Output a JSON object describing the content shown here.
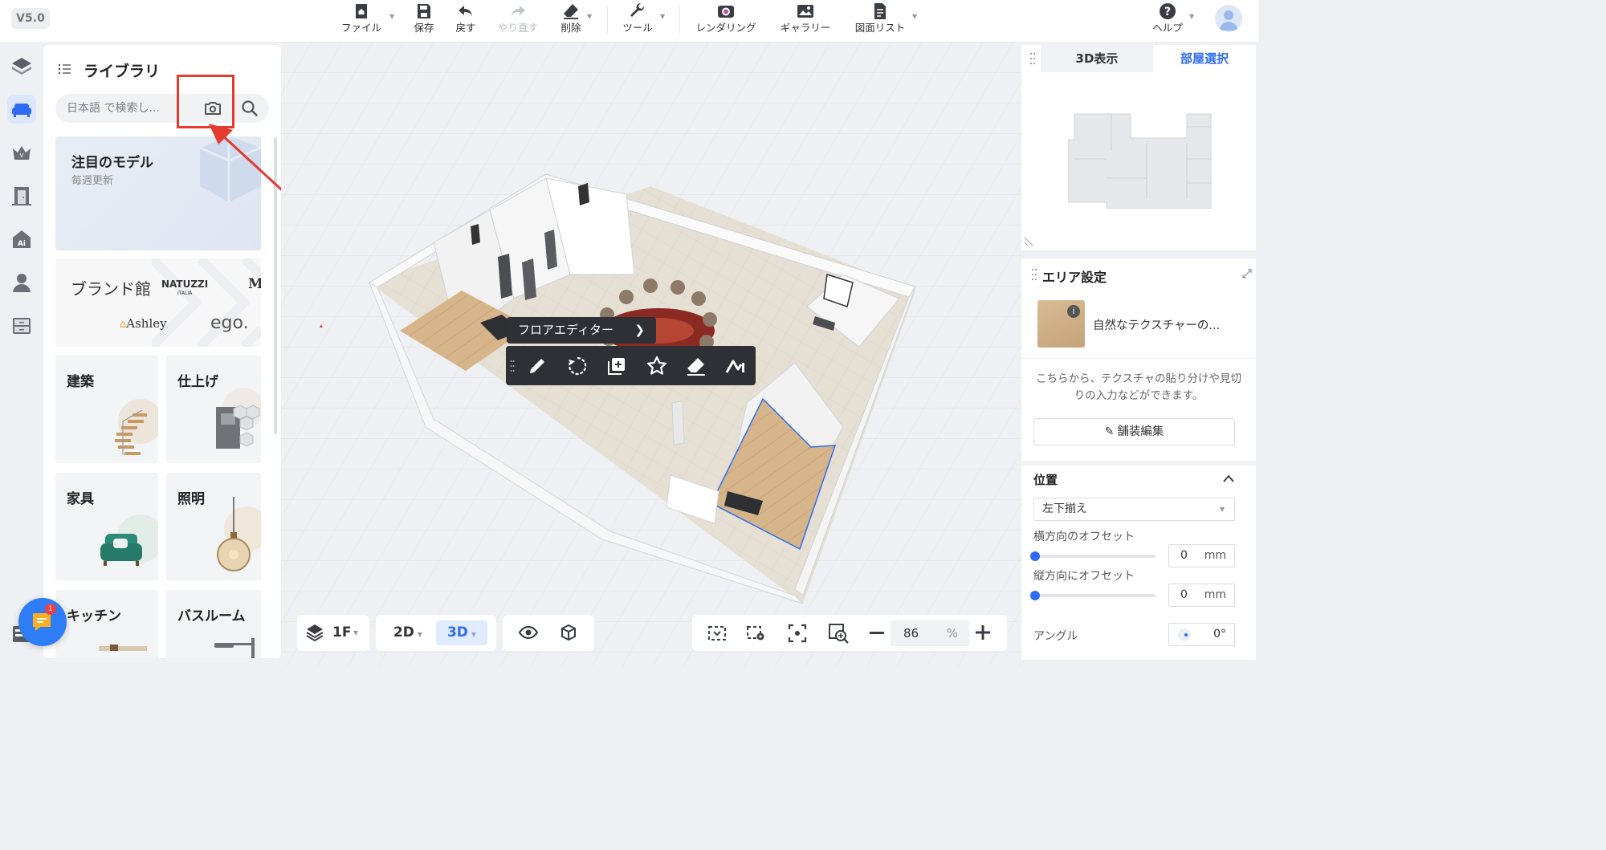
{
  "app": {
    "version": "V5.0"
  },
  "toolbar": {
    "file": "ファイル",
    "save": "保存",
    "undo": "戻す",
    "redo": "やり直す",
    "delete": "削除",
    "tools": "ツール",
    "rendering": "レンダリング",
    "gallery": "ギャラリー",
    "drawing_list": "図面リスト",
    "help": "ヘルプ"
  },
  "library": {
    "title": "ライブラリ",
    "search_placeholder": "日本語 で検索し...",
    "featured": {
      "title": "注目のモデル",
      "subtitle": "毎週更新"
    },
    "brand": {
      "title": "ブランド館",
      "logos": [
        "NATUZZI",
        "ITALIA",
        "M",
        "Ashley",
        "ego."
      ]
    },
    "categories": [
      "建築",
      "仕上げ",
      "家具",
      "照明",
      "キッチン",
      "バスルーム"
    ]
  },
  "canvas": {
    "floor_editor_label": "フロアエディター",
    "floor": "1F",
    "mode_2d": "2D",
    "mode_3d": "3D",
    "zoom_value": "86",
    "zoom_unit": "%"
  },
  "view_panel": {
    "tabs": [
      "3D表示",
      "部屋選択"
    ],
    "active_tab": "部屋選択"
  },
  "area_panel": {
    "title": "エリア設定",
    "material_name": "自然なテクスチャーの...",
    "description": "こちらから、テクスチャの貼り分けや見切りの入力などができます。",
    "pave_button": "舗装編集",
    "position_title": "位置",
    "alignment": "左下揃え",
    "h_offset_label": "横方向のオフセット",
    "h_offset_value": "0",
    "v_offset_label": "縦方向にオフセット",
    "v_offset_value": "0",
    "unit": "mm",
    "angle_label": "アングル",
    "angle_value": "0°"
  },
  "chat": {
    "badge": "1"
  },
  "colors": {
    "accent": "#2e6cf6",
    "highlight": "#e53a2e",
    "dark_bar": "#2f3035"
  }
}
